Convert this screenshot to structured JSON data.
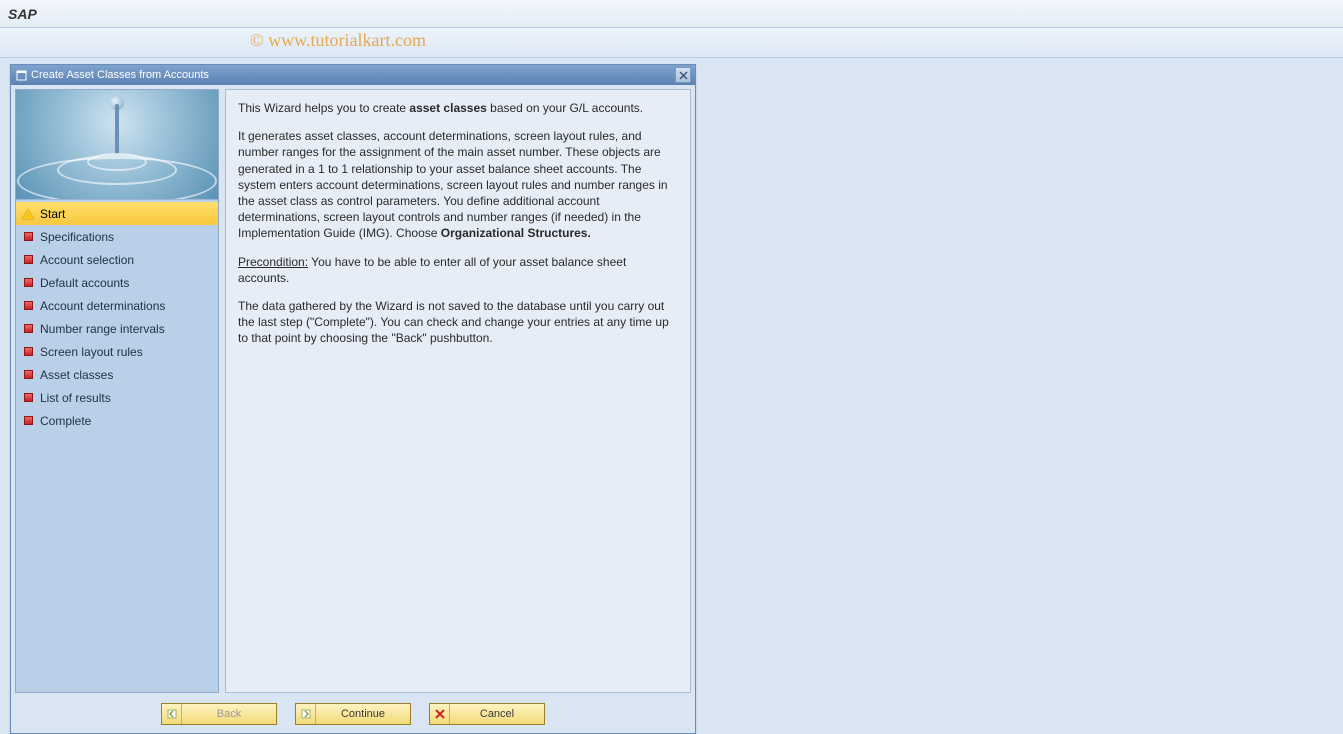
{
  "header": {
    "app_title": "SAP"
  },
  "watermark": "© www.tutorialkart.com",
  "dialog": {
    "title": "Create Asset Classes from Accounts",
    "steps": [
      {
        "label": "Start",
        "icon": "warning",
        "active": true
      },
      {
        "label": "Specifications",
        "icon": "pending",
        "active": false
      },
      {
        "label": "Account selection",
        "icon": "pending",
        "active": false
      },
      {
        "label": "Default accounts",
        "icon": "pending",
        "active": false
      },
      {
        "label": "Account determinations",
        "icon": "pending",
        "active": false
      },
      {
        "label": "Number range intervals",
        "icon": "pending",
        "active": false
      },
      {
        "label": "Screen layout rules",
        "icon": "pending",
        "active": false
      },
      {
        "label": "Asset classes",
        "icon": "pending",
        "active": false
      },
      {
        "label": "List of results",
        "icon": "pending",
        "active": false
      },
      {
        "label": "Complete",
        "icon": "pending",
        "active": false
      }
    ],
    "content": {
      "p1_a": "This Wizard helps you to create ",
      "p1_b": "asset classes",
      "p1_c": " based on your G/L accounts.",
      "p2_a": "It generates asset classes, account determinations, screen layout rules, and number ranges for the assignment of the main asset number. These objects are generated in a 1 to 1 relationship to your asset balance sheet accounts. The system enters account determinations, screen layout rules and number ranges in the asset class as control parameters. You define additional account determinations, screen layout controls and number ranges (if needed) in the Implementation Guide (IMG). Choose ",
      "p2_b": "Organizational Structures.",
      "p3_a": "Precondition:",
      "p3_b": " You have to be able to enter all of your asset balance sheet accounts.",
      "p4": "The data gathered by the Wizard is not saved to the database until you carry out the last step (\"Complete\"). You can check and change your entries at any time up to that point by choosing the \"Back\" pushbutton."
    },
    "buttons": {
      "back": "Back",
      "continue": "Continue",
      "cancel": "Cancel"
    }
  }
}
